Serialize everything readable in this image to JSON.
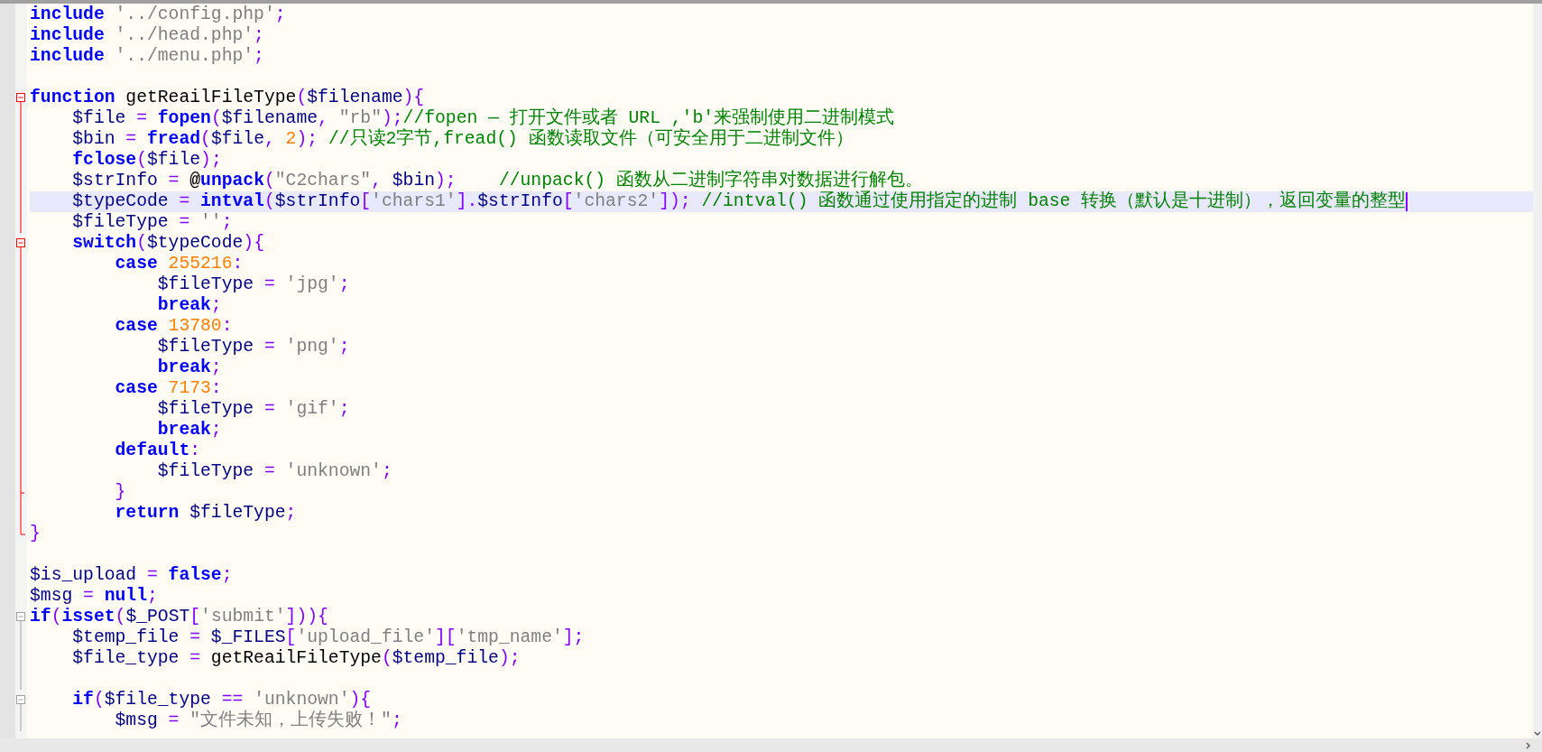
{
  "editor": {
    "lines": [
      {
        "current": false,
        "tokens": [
          {
            "kind": "kw",
            "text": "include"
          },
          {
            "kind": "str",
            "text": " '../config.php'"
          },
          {
            "kind": "op",
            "text": ";"
          }
        ]
      },
      {
        "current": false,
        "tokens": [
          {
            "kind": "kw",
            "text": "include"
          },
          {
            "kind": "str",
            "text": " '../head.php'"
          },
          {
            "kind": "op",
            "text": ";"
          }
        ]
      },
      {
        "current": false,
        "tokens": [
          {
            "kind": "kw",
            "text": "include"
          },
          {
            "kind": "str",
            "text": " '../menu.php'"
          },
          {
            "kind": "op",
            "text": ";"
          }
        ]
      },
      {
        "current": false
      },
      {
        "current": false,
        "fold": {
          "kind": "start",
          "active": true
        },
        "tokens": [
          {
            "kind": "kw",
            "text": "function"
          },
          {
            "kind": "p",
            "text": " getReailFileType"
          },
          {
            "kind": "op",
            "text": "("
          },
          {
            "kind": "var",
            "text": "$filename"
          },
          {
            "kind": "op",
            "text": "){"
          }
        ]
      },
      {
        "current": false,
        "fold": {
          "kind": "body",
          "active": true
        },
        "tokens": [
          {
            "kind": "var",
            "text": "    $file"
          },
          {
            "kind": "op",
            "text": " = "
          },
          {
            "kind": "kw",
            "text": "fopen"
          },
          {
            "kind": "op",
            "text": "("
          },
          {
            "kind": "var",
            "text": "$filename"
          },
          {
            "kind": "op",
            "text": ", "
          },
          {
            "kind": "str",
            "text": "\"rb\""
          },
          {
            "kind": "op",
            "text": ");"
          },
          {
            "kind": "cmt",
            "text": "//fopen — 打开文件或者 URL ,'b'来强制使用二进制模式"
          }
        ]
      },
      {
        "current": false,
        "fold": {
          "kind": "body",
          "active": true
        },
        "tokens": [
          {
            "kind": "var",
            "text": "    $bin"
          },
          {
            "kind": "op",
            "text": " = "
          },
          {
            "kind": "kw",
            "text": "fread"
          },
          {
            "kind": "op",
            "text": "("
          },
          {
            "kind": "var",
            "text": "$file"
          },
          {
            "kind": "op",
            "text": ", "
          },
          {
            "kind": "num",
            "text": "2"
          },
          {
            "kind": "op",
            "text": "); "
          },
          {
            "kind": "cmt",
            "text": "//只读2字节,fread() 函数读取文件（可安全用于二进制文件）"
          }
        ]
      },
      {
        "current": false,
        "fold": {
          "kind": "body",
          "active": true
        },
        "tokens": [
          {
            "kind": "kw",
            "text": "    fclose"
          },
          {
            "kind": "op",
            "text": "("
          },
          {
            "kind": "var",
            "text": "$file"
          },
          {
            "kind": "op",
            "text": ");"
          }
        ]
      },
      {
        "current": false,
        "fold": {
          "kind": "body",
          "active": true
        },
        "tokens": [
          {
            "kind": "var",
            "text": "    $strInfo"
          },
          {
            "kind": "op",
            "text": " = "
          },
          {
            "kind": "at",
            "text": "@"
          },
          {
            "kind": "kw",
            "text": "unpack"
          },
          {
            "kind": "op",
            "text": "("
          },
          {
            "kind": "str",
            "text": "\"C2chars\""
          },
          {
            "kind": "op",
            "text": ", "
          },
          {
            "kind": "var",
            "text": "$bin"
          },
          {
            "kind": "op",
            "text": ");"
          },
          {
            "kind": "cmt",
            "text": "    //unpack() 函数从二进制字符串对数据进行解包。"
          }
        ]
      },
      {
        "current": true,
        "fold": {
          "kind": "body",
          "active": true
        },
        "tokens": [
          {
            "kind": "var",
            "text": "    $typeCode"
          },
          {
            "kind": "op",
            "text": " = "
          },
          {
            "kind": "kw",
            "text": "intval"
          },
          {
            "kind": "op",
            "text": "("
          },
          {
            "kind": "var",
            "text": "$strInfo"
          },
          {
            "kind": "op",
            "text": "["
          },
          {
            "kind": "str",
            "text": "'chars1'"
          },
          {
            "kind": "op",
            "text": "]."
          },
          {
            "kind": "var",
            "text": "$strInfo"
          },
          {
            "kind": "op",
            "text": "["
          },
          {
            "kind": "str",
            "text": "'chars2'"
          },
          {
            "kind": "op",
            "text": "]);"
          },
          {
            "kind": "cmt",
            "text": " //intval() 函数通过使用指定的进制 base 转换（默认是十进制），返回变量的整型"
          }
        ]
      },
      {
        "current": false,
        "fold": {
          "kind": "body",
          "active": true
        },
        "tokens": [
          {
            "kind": "var",
            "text": "    $fileType"
          },
          {
            "kind": "op",
            "text": " = "
          },
          {
            "kind": "str",
            "text": "''"
          },
          {
            "kind": "op",
            "text": ";"
          }
        ]
      },
      {
        "current": false,
        "fold": {
          "kind": "start",
          "active": true
        },
        "tokens": [
          {
            "kind": "kw",
            "text": "    switch"
          },
          {
            "kind": "op",
            "text": "("
          },
          {
            "kind": "var",
            "text": "$typeCode"
          },
          {
            "kind": "op",
            "text": "){"
          }
        ]
      },
      {
        "current": false,
        "fold": {
          "kind": "body",
          "active": true
        },
        "tokens": [
          {
            "kind": "kw",
            "text": "        case"
          },
          {
            "kind": "num",
            "text": " 255216"
          },
          {
            "kind": "op",
            "text": ":"
          }
        ]
      },
      {
        "current": false,
        "fold": {
          "kind": "body",
          "active": true
        },
        "tokens": [
          {
            "kind": "var",
            "text": "            $fileType"
          },
          {
            "kind": "op",
            "text": " = "
          },
          {
            "kind": "str",
            "text": "'jpg'"
          },
          {
            "kind": "op",
            "text": ";"
          }
        ]
      },
      {
        "current": false,
        "fold": {
          "kind": "body",
          "active": true
        },
        "tokens": [
          {
            "kind": "kw",
            "text": "            break"
          },
          {
            "kind": "op",
            "text": ";"
          }
        ]
      },
      {
        "current": false,
        "fold": {
          "kind": "body",
          "active": true
        },
        "tokens": [
          {
            "kind": "kw",
            "text": "        case"
          },
          {
            "kind": "num",
            "text": " 13780"
          },
          {
            "kind": "op",
            "text": ":"
          }
        ]
      },
      {
        "current": false,
        "fold": {
          "kind": "body",
          "active": true
        },
        "tokens": [
          {
            "kind": "var",
            "text": "            $fileType"
          },
          {
            "kind": "op",
            "text": " = "
          },
          {
            "kind": "str",
            "text": "'png'"
          },
          {
            "kind": "op",
            "text": ";"
          }
        ]
      },
      {
        "current": false,
        "fold": {
          "kind": "body",
          "active": true
        },
        "tokens": [
          {
            "kind": "kw",
            "text": "            break"
          },
          {
            "kind": "op",
            "text": ";"
          }
        ]
      },
      {
        "current": false,
        "fold": {
          "kind": "body",
          "active": true
        },
        "tokens": [
          {
            "kind": "kw",
            "text": "        case"
          },
          {
            "kind": "num",
            "text": " 7173"
          },
          {
            "kind": "op",
            "text": ":"
          }
        ]
      },
      {
        "current": false,
        "fold": {
          "kind": "body",
          "active": true
        },
        "tokens": [
          {
            "kind": "var",
            "text": "            $fileType"
          },
          {
            "kind": "op",
            "text": " = "
          },
          {
            "kind": "str",
            "text": "'gif'"
          },
          {
            "kind": "op",
            "text": ";"
          }
        ]
      },
      {
        "current": false,
        "fold": {
          "kind": "body",
          "active": true
        },
        "tokens": [
          {
            "kind": "kw",
            "text": "            break"
          },
          {
            "kind": "op",
            "text": ";"
          }
        ]
      },
      {
        "current": false,
        "fold": {
          "kind": "body",
          "active": true
        },
        "tokens": [
          {
            "kind": "kw",
            "text": "        default"
          },
          {
            "kind": "op",
            "text": ":"
          }
        ]
      },
      {
        "current": false,
        "fold": {
          "kind": "body",
          "active": true
        },
        "tokens": [
          {
            "kind": "var",
            "text": "            $fileType"
          },
          {
            "kind": "op",
            "text": " = "
          },
          {
            "kind": "str",
            "text": "'unknown'"
          },
          {
            "kind": "op",
            "text": ";"
          }
        ]
      },
      {
        "current": false,
        "fold": {
          "kind": "tick",
          "active": true
        },
        "tokens": [
          {
            "kind": "op",
            "text": "        }"
          }
        ]
      },
      {
        "current": false,
        "fold": {
          "kind": "body",
          "active": true
        },
        "tokens": [
          {
            "kind": "kw",
            "text": "        return"
          },
          {
            "kind": "var",
            "text": " $fileType"
          },
          {
            "kind": "op",
            "text": ";"
          }
        ]
      },
      {
        "current": false,
        "fold": {
          "kind": "end",
          "active": true
        },
        "tokens": [
          {
            "kind": "op",
            "text": "}"
          }
        ]
      },
      {
        "current": false
      },
      {
        "current": false,
        "tokens": [
          {
            "kind": "var",
            "text": "$is_upload"
          },
          {
            "kind": "op",
            "text": " = "
          },
          {
            "kind": "kw",
            "text": "false"
          },
          {
            "kind": "op",
            "text": ";"
          }
        ]
      },
      {
        "current": false,
        "tokens": [
          {
            "kind": "var",
            "text": "$msg"
          },
          {
            "kind": "op",
            "text": " = "
          },
          {
            "kind": "kw",
            "text": "null"
          },
          {
            "kind": "op",
            "text": ";"
          }
        ]
      },
      {
        "current": false,
        "fold": {
          "kind": "start",
          "active": false
        },
        "tokens": [
          {
            "kind": "kw",
            "text": "if"
          },
          {
            "kind": "op",
            "text": "("
          },
          {
            "kind": "kw",
            "text": "isset"
          },
          {
            "kind": "op",
            "text": "("
          },
          {
            "kind": "var",
            "text": "$_POST"
          },
          {
            "kind": "op",
            "text": "["
          },
          {
            "kind": "str",
            "text": "'submit'"
          },
          {
            "kind": "op",
            "text": "])){"
          }
        ]
      },
      {
        "current": false,
        "fold": {
          "kind": "body",
          "active": false
        },
        "tokens": [
          {
            "kind": "var",
            "text": "    $temp_file"
          },
          {
            "kind": "op",
            "text": " = "
          },
          {
            "kind": "var",
            "text": "$_FILES"
          },
          {
            "kind": "op",
            "text": "["
          },
          {
            "kind": "str",
            "text": "'upload_file'"
          },
          {
            "kind": "op",
            "text": "]["
          },
          {
            "kind": "str",
            "text": "'tmp_name'"
          },
          {
            "kind": "op",
            "text": "];"
          }
        ]
      },
      {
        "current": false,
        "fold": {
          "kind": "body",
          "active": false
        },
        "tokens": [
          {
            "kind": "var",
            "text": "    $file_type"
          },
          {
            "kind": "op",
            "text": " = "
          },
          {
            "kind": "p",
            "text": "getReailFileType"
          },
          {
            "kind": "op",
            "text": "("
          },
          {
            "kind": "var",
            "text": "$temp_file"
          },
          {
            "kind": "op",
            "text": ");"
          }
        ]
      },
      {
        "current": false,
        "fold": {
          "kind": "body",
          "active": false
        }
      },
      {
        "current": false,
        "fold": {
          "kind": "start",
          "active": false
        },
        "tokens": [
          {
            "kind": "kw",
            "text": "    if"
          },
          {
            "kind": "op",
            "text": "("
          },
          {
            "kind": "var",
            "text": "$file_type"
          },
          {
            "kind": "op",
            "text": " == "
          },
          {
            "kind": "str",
            "text": "'unknown'"
          },
          {
            "kind": "op",
            "text": "){"
          }
        ]
      },
      {
        "current": false,
        "fold": {
          "kind": "body",
          "active": false
        },
        "tokens": [
          {
            "kind": "var",
            "text": "        $msg"
          },
          {
            "kind": "op",
            "text": " = "
          },
          {
            "kind": "str",
            "text": "\"文件未知，上传失败！\""
          },
          {
            "kind": "op",
            "text": ";"
          }
        ]
      }
    ]
  }
}
